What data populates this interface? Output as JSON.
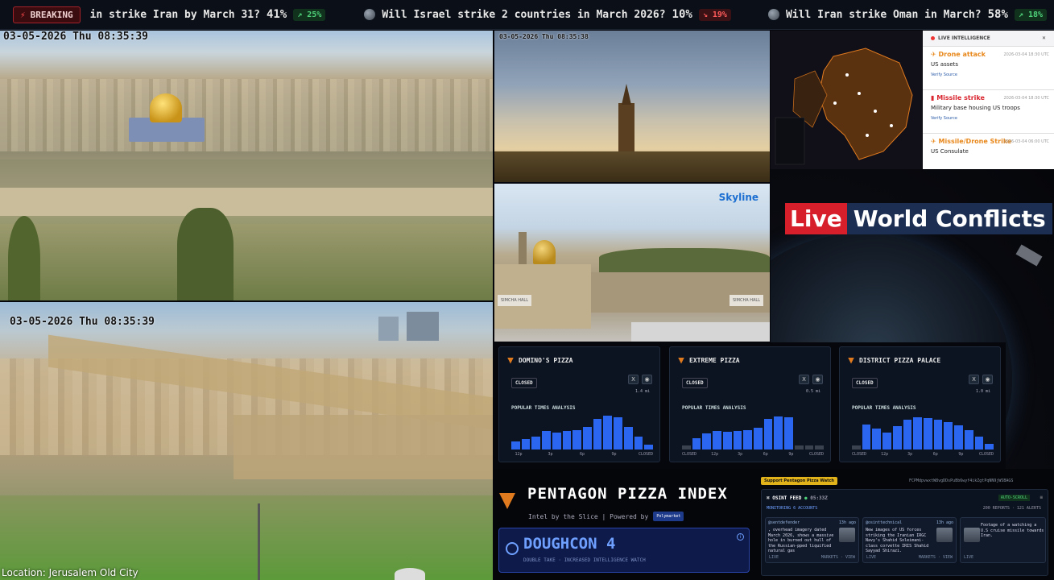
{
  "ticker": {
    "breaking_label": "BREAKING",
    "items": [
      {
        "question": "in strike Iran by March 31?",
        "percent": "41%",
        "change": "25%",
        "direction": "up"
      },
      {
        "question": "Will Israel strike 2 countries in March 2026?",
        "percent": "10%",
        "change": "19%",
        "direction": "down"
      },
      {
        "question": "Will Iran strike Oman in March?",
        "percent": "58%",
        "change": "18%",
        "direction": "up"
      }
    ]
  },
  "cameras": {
    "cam1_timestamp": "03-05-2026 Thu 08:35:39",
    "cam2_timestamp": "03-05-2026 Thu 08:35:39",
    "cam3_timestamp": "03-05-2026 Thu 08:35:38",
    "cam4_brand": "Skyline",
    "cam4_sign_left": "SIMCHA HALL",
    "cam4_sign_right": "SIMCHA HALL"
  },
  "location": "Location: Jerusalem Old City",
  "intel": {
    "header": "LIVE INTELLIGENCE",
    "cards": [
      {
        "type": "Drone attack",
        "time": "2026-03-04 18:30 UTC",
        "subject": "US assets",
        "verify": "Verify Source",
        "color": "#e8871a"
      },
      {
        "type": "Missile strike",
        "time": "2026-03-04 18:30 UTC",
        "subject": "Military base housing US troops",
        "verify": "Verify Source",
        "color": "#d9262f"
      },
      {
        "type": "Missile/Drone Strike",
        "time": "2026-03-04 06:00 UTC",
        "subject": "US Consulate",
        "verify": "",
        "color": "#e8871a"
      }
    ]
  },
  "live_world_conflicts": {
    "word1": "Live",
    "word2": "World Conflicts"
  },
  "pizza": {
    "popular_label": "POPULAR TIMES ANALYSIS",
    "stores": [
      {
        "name": "DOMINO'S PIZZA",
        "status": "CLOSED",
        "distance": "1.4 mi",
        "ticks": [
          "12p",
          "3p",
          "6p",
          "9p",
          "CLOSED"
        ],
        "bars": [
          0.22,
          0.27,
          0.34,
          0.48,
          0.45,
          0.48,
          0.52,
          0.6,
          0.8,
          0.9,
          0.85,
          0.6,
          0.35,
          0.12
        ]
      },
      {
        "name": "EXTREME PIZZA",
        "status": "CLOSED",
        "distance": "0.5 mi",
        "ticks": [
          "CLOSED",
          "12p",
          "3p",
          "6p",
          "9p",
          "CLOSED"
        ],
        "bars": [
          0.1,
          0.3,
          0.42,
          0.5,
          0.46,
          0.5,
          0.52,
          0.58,
          0.8,
          0.88,
          0.86,
          0.1,
          0.1,
          0.1
        ]
      },
      {
        "name": "DISTRICT PIZZA PALACE",
        "status": "CLOSED",
        "distance": "1.0 mi",
        "ticks": [
          "CLOSED",
          "12p",
          "3p",
          "6p",
          "9p",
          "CLOSED"
        ],
        "bars": [
          0.1,
          0.65,
          0.55,
          0.45,
          0.62,
          0.78,
          0.86,
          0.84,
          0.78,
          0.72,
          0.64,
          0.52,
          0.34,
          0.14
        ]
      }
    ],
    "active_color": "#2a66f0",
    "closed_color": "#3a4250"
  },
  "ppi": {
    "title": "PENTAGON PIZZA INDEX",
    "subtitle": "Intel by the Slice | Powered by",
    "powered_badge": "Polymarket",
    "doughcon_level": "DOUGHCON 4",
    "doughcon_desc": "DOUBLE TAKE · INCREASED INTELLIGENCE WATCH"
  },
  "osint": {
    "support_label": "Support Pentagon Pizza Watch",
    "hash": "FCPMdpvwxtW8vgDDsPuBb6wyf4ikZgtPqNN9jWSBAGS",
    "title": "OSINT FEED",
    "time": "05:33Z",
    "auto_scroll": "AUTO-SCROLL",
    "monitoring": "MONITORING 6 ACCOUNTS",
    "stats": "200 REPORTS · 121 ALERTS",
    "posts": [
      {
        "handle": "@sentdefender",
        "age": "13h ago",
        "text": ", overhead imagery dated March 2026, shows a massive hole in burned out hull of the Russian-pped liquified natural gas",
        "live": "LIVE",
        "markets": "MARKETS",
        "view": "VIEW"
      },
      {
        "handle": "@osinttechnical",
        "age": "13h ago",
        "text": "New images of US forces striking the Iranian IRGC Navy's Shahid Soleimani-class corvette IRIS Shahid Sayyad Shirazi.",
        "live": "LIVE",
        "markets": "MARKETS",
        "view": "VIEW"
      },
      {
        "handle": "",
        "age": "",
        "text": "Footage of a watching a U.S cruise missile towards Iran.",
        "live": "LIVE",
        "markets": "",
        "view": ""
      }
    ]
  }
}
